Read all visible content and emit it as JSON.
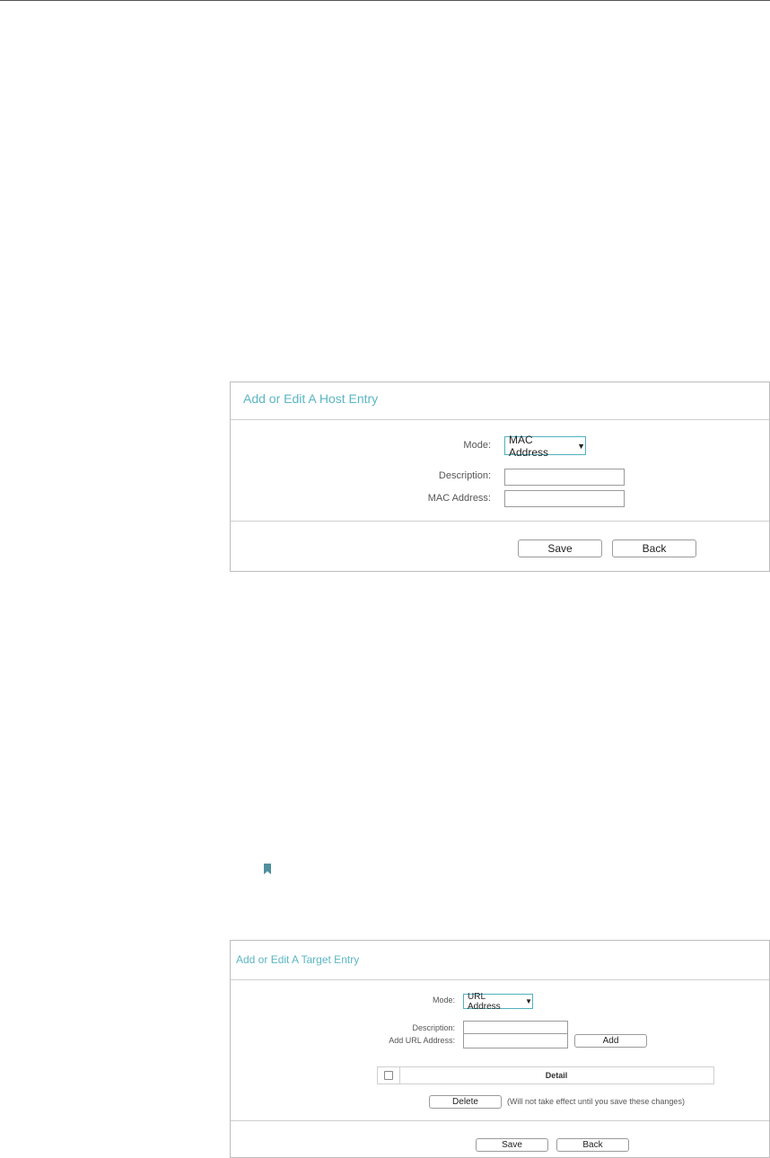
{
  "host_panel": {
    "title": "Add or Edit A Host Entry",
    "mode_label": "Mode:",
    "mode_value": "MAC Address",
    "description_label": "Description:",
    "description_value": "",
    "mac_label": "MAC Address:",
    "mac_value": "",
    "save_label": "Save",
    "back_label": "Back"
  },
  "bookmark_icon": "bookmark-icon",
  "target_panel": {
    "title": "Add or Edit A Target Entry",
    "mode_label": "Mode:",
    "mode_value": "URL Address",
    "description_label": "Description:",
    "description_value": "",
    "url_label": "Add URL Address:",
    "url_value": "",
    "add_label": "Add",
    "table_header": "Detail",
    "delete_label": "Delete",
    "delete_note": "(Will not take effect until you save these changes)",
    "save_label": "Save",
    "back_label": "Back"
  },
  "colors": {
    "accent": "#5bb6c4",
    "select_border": "#4fb1bf",
    "bookmark": "#4f8f9e"
  }
}
